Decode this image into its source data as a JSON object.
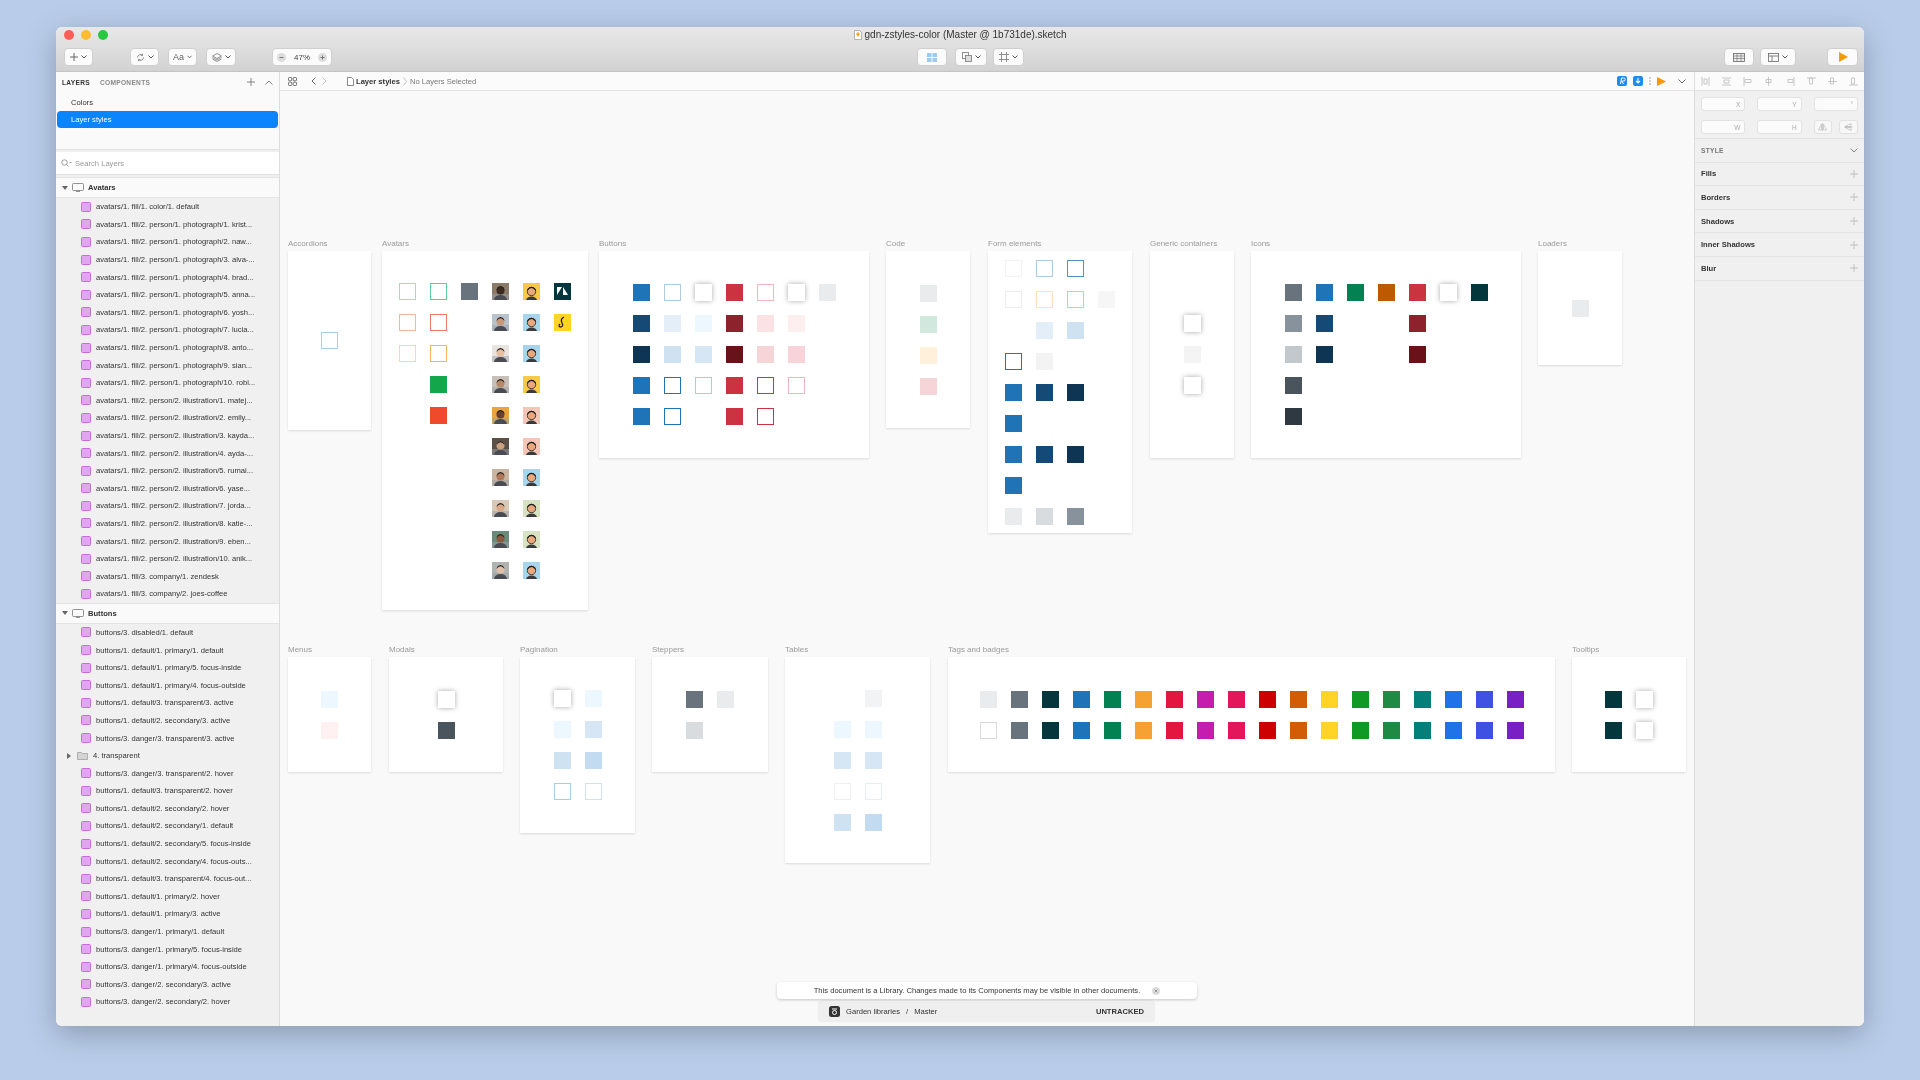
{
  "window": {
    "title": "gdn-zstyles-color (Master @ 1b731de).sketch"
  },
  "toolbar": {
    "text_tool": "Aa",
    "zoom": "47%"
  },
  "sidebar": {
    "tabs": [
      {
        "label": "LAYERS",
        "selected": true
      },
      {
        "label": "COMPONENTS",
        "selected": false
      }
    ],
    "pages": [
      {
        "label": "Colors",
        "selected": false
      },
      {
        "label": "Layer styles",
        "selected": true
      }
    ],
    "search": {
      "placeholder": "Search Layers"
    },
    "groups": [
      {
        "name": "Avatars",
        "expanded": true,
        "children": [
          {
            "kind": "style",
            "label": "avatars/1. fill/1. color/1. default"
          },
          {
            "kind": "style",
            "label": "avatars/1. fill/2. person/1. photograph/1. krist..."
          },
          {
            "kind": "style",
            "label": "avatars/1. fill/2. person/1. photograph/2. naw..."
          },
          {
            "kind": "style",
            "label": "avatars/1. fill/2. person/1. photograph/3. alva-..."
          },
          {
            "kind": "style",
            "label": "avatars/1. fill/2. person/1. photograph/4. brad..."
          },
          {
            "kind": "style",
            "label": "avatars/1. fill/2. person/1. photograph/5. anna..."
          },
          {
            "kind": "style",
            "label": "avatars/1. fill/2. person/1. photograph/6. yosh..."
          },
          {
            "kind": "style",
            "label": "avatars/1. fill/2. person/1. photograph/7. lucia..."
          },
          {
            "kind": "style",
            "label": "avatars/1. fill/2. person/1. photograph/8. anto..."
          },
          {
            "kind": "style",
            "label": "avatars/1. fill/2. person/1. photograph/9. sian..."
          },
          {
            "kind": "style",
            "label": "avatars/1. fill/2. person/1. photograph/10. robi..."
          },
          {
            "kind": "style",
            "label": "avatars/1. fill/2. person/2. illustration/1. matej..."
          },
          {
            "kind": "style",
            "label": "avatars/1. fill/2. person/2. illustration/2. emily..."
          },
          {
            "kind": "style",
            "label": "avatars/1. fill/2. person/2. illustration/3. kayda..."
          },
          {
            "kind": "style",
            "label": "avatars/1. fill/2. person/2. illustration/4. ayda-..."
          },
          {
            "kind": "style",
            "label": "avatars/1. fill/2. person/2. illustration/5. rumai..."
          },
          {
            "kind": "style",
            "label": "avatars/1. fill/2. person/2. illustration/6. yase..."
          },
          {
            "kind": "style",
            "label": "avatars/1. fill/2. person/2. illustration/7. jorda..."
          },
          {
            "kind": "style",
            "label": "avatars/1. fill/2. person/2. illustration/8. katie-..."
          },
          {
            "kind": "style",
            "label": "avatars/1. fill/2. person/2. illustration/9. eben..."
          },
          {
            "kind": "style",
            "label": "avatars/1. fill/2. person/2. illustration/10. anik..."
          },
          {
            "kind": "style",
            "label": "avatars/1. fill/3. company/1. zendesk"
          },
          {
            "kind": "style",
            "label": "avatars/1. fill/3. company/2. joes-coffee"
          }
        ]
      },
      {
        "name": "Buttons",
        "expanded": true,
        "children": [
          {
            "kind": "style",
            "label": "buttons/3. disabled/1. default"
          },
          {
            "kind": "style",
            "label": "buttons/1. default/1. primary/1. default"
          },
          {
            "kind": "style",
            "label": "buttons/1. default/1. primary/5. focus-inside"
          },
          {
            "kind": "style",
            "label": "buttons/1. default/1. primary/4. focus-outside"
          },
          {
            "kind": "style",
            "label": "buttons/1. default/3. transparent/3. active"
          },
          {
            "kind": "style",
            "label": "buttons/1. default/2. secondary/3. active"
          },
          {
            "kind": "style",
            "label": "buttons/3. danger/3. transparent/3. active"
          },
          {
            "kind": "folder",
            "label": "4. transparent",
            "expanded": false
          },
          {
            "kind": "style",
            "label": "buttons/3. danger/3. transparent/2. hover"
          },
          {
            "kind": "style",
            "label": "buttons/1. default/3. transparent/2. hover"
          },
          {
            "kind": "style",
            "label": "buttons/1. default/2. secondary/2. hover"
          },
          {
            "kind": "style",
            "label": "buttons/1. default/2. secondary/1. default"
          },
          {
            "kind": "style",
            "label": "buttons/1. default/2. secondary/5. focus-inside"
          },
          {
            "kind": "style",
            "label": "buttons/1. default/2. secondary/4. focus-outs..."
          },
          {
            "kind": "style",
            "label": "buttons/1. default/3. transparent/4. focus-out..."
          },
          {
            "kind": "style",
            "label": "buttons/1. default/1. primary/2. hover"
          },
          {
            "kind": "style",
            "label": "buttons/1. default/1. primary/3. active"
          },
          {
            "kind": "style",
            "label": "buttons/3. danger/1. primary/1. default"
          },
          {
            "kind": "style",
            "label": "buttons/3. danger/1. primary/5. focus-inside"
          },
          {
            "kind": "style",
            "label": "buttons/3. danger/1. primary/4. focus-outside"
          },
          {
            "kind": "style",
            "label": "buttons/3. danger/2. secondary/3. active"
          },
          {
            "kind": "style",
            "label": "buttons/3. danger/2. secondary/2. hover"
          }
        ]
      }
    ]
  },
  "breadcrumb": {
    "page": "Layer styles",
    "selection": "No Layers Selected"
  },
  "canvas": {
    "artboards": [
      {
        "title": "Accordions",
        "rows": [
          [
            {
              "kind": "outline",
              "color": "#adcce4"
            }
          ]
        ]
      },
      {
        "title": "Avatars",
        "rows": [
          [
            {
              "kind": "outline",
              "color": "#9fe0bf"
            },
            {
              "kind": "outline",
              "color": "#5ccf96"
            },
            {
              "kind": "fill",
              "color": "#68737d"
            },
            {
              "kind": "picture"
            },
            {
              "kind": "person",
              "color": "#f7c948"
            },
            {
              "kind": "logo",
              "color": "#03363d"
            }
          ],
          [
            {
              "kind": "outline",
              "color": "#f9b2a7"
            },
            {
              "kind": "outline",
              "color": "#f07a68"
            },
            {
              "kind": "gap"
            },
            {
              "kind": "picture"
            },
            {
              "kind": "person",
              "color": "#a8d4ec"
            },
            {
              "kind": "logo",
              "color": "#ffd424"
            }
          ],
          [
            {
              "kind": "outline",
              "color": "#fdd6a0"
            },
            {
              "kind": "outline",
              "color": "#f9b45a"
            },
            {
              "kind": "gap"
            },
            {
              "kind": "picture"
            },
            {
              "kind": "person",
              "color": "#a8d4ec"
            }
          ],
          [
            {
              "kind": "gap"
            },
            {
              "kind": "fill",
              "color": "#13a64a"
            },
            {
              "kind": "gap"
            },
            {
              "kind": "picture"
            },
            {
              "kind": "person",
              "color": "#f7c948"
            }
          ],
          [
            {
              "kind": "gap"
            },
            {
              "kind": "fill",
              "color": "#ef4a2c"
            },
            {
              "kind": "gap"
            },
            {
              "kind": "picture"
            },
            {
              "kind": "person",
              "color": "#f5c6b8"
            }
          ],
          [
            {
              "kind": "gap"
            },
            {
              "kind": "gap"
            },
            {
              "kind": "gap"
            },
            {
              "kind": "picture"
            },
            {
              "kind": "person",
              "color": "#f5c6b8"
            }
          ],
          [
            {
              "kind": "gap"
            },
            {
              "kind": "gap"
            },
            {
              "kind": "gap"
            },
            {
              "kind": "picture"
            },
            {
              "kind": "person",
              "color": "#a8d4ec"
            }
          ],
          [
            {
              "kind": "gap"
            },
            {
              "kind": "gap"
            },
            {
              "kind": "gap"
            },
            {
              "kind": "picture"
            },
            {
              "kind": "person",
              "color": "#d7e2c2"
            }
          ],
          [
            {
              "kind": "gap"
            },
            {
              "kind": "gap"
            },
            {
              "kind": "gap"
            },
            {
              "kind": "picture"
            },
            {
              "kind": "person",
              "color": "#d7e2c2"
            }
          ],
          [
            {
              "kind": "gap"
            },
            {
              "kind": "gap"
            },
            {
              "kind": "gap"
            },
            {
              "kind": "picture"
            },
            {
              "kind": "person",
              "color": "#a8d4ec"
            }
          ]
        ]
      },
      {
        "title": "Buttons",
        "rows": [
          [
            {
              "kind": "fill",
              "color": "#1f73b7"
            },
            {
              "kind": "outline",
              "color": "#adcce4"
            },
            {
              "kind": "shadow"
            },
            {
              "kind": "fill",
              "color": "#cc3340"
            },
            {
              "kind": "outline",
              "color": "#f5b5ba"
            },
            {
              "kind": "shadow"
            },
            {
              "kind": "fill",
              "color": "#e9ebed"
            }
          ],
          [
            {
              "kind": "fill",
              "color": "#144a75"
            },
            {
              "kind": "fill",
              "color": "#e3eef8"
            },
            {
              "kind": "fill",
              "color": "#edf7ff"
            },
            {
              "kind": "fill",
              "color": "#8c232c"
            },
            {
              "kind": "fill",
              "color": "#fbe3e5"
            },
            {
              "kind": "fill",
              "color": "#fdeff0"
            }
          ],
          [
            {
              "kind": "fill",
              "color": "#0f3554"
            },
            {
              "kind": "fill",
              "color": "#cee2f2"
            },
            {
              "kind": "fill",
              "color": "#d6e6f5"
            },
            {
              "kind": "fill",
              "color": "#681219"
            },
            {
              "kind": "fill",
              "color": "#f5d5d8"
            },
            {
              "kind": "fill",
              "color": "#f8d3d9"
            }
          ],
          [
            {
              "kind": "fill",
              "color": "#1f73b7"
            },
            {
              "kind": "outline",
              "color": "#1f73b7"
            },
            {
              "kind": "outline",
              "color": "#adcce4"
            },
            {
              "kind": "fill",
              "color": "#cc3340"
            },
            {
              "kind": "outline",
              "color": "#cc3340"
            },
            {
              "kind": "outline",
              "color": "#f5b5ba"
            }
          ],
          [
            {
              "kind": "fill",
              "color": "#1f73b7"
            },
            {
              "kind": "outline",
              "color": "#1f73b7"
            },
            {
              "kind": "gap"
            },
            {
              "kind": "fill",
              "color": "#cc3340"
            },
            {
              "kind": "outline",
              "color": "#cc3340"
            }
          ]
        ]
      },
      {
        "title": "Code",
        "rows": [
          [
            {
              "kind": "fill",
              "color": "#e9ebed"
            }
          ],
          [
            {
              "kind": "fill",
              "color": "#d1e8df"
            }
          ],
          [
            {
              "kind": "fill",
              "color": "#fff0db"
            }
          ],
          [
            {
              "kind": "fill",
              "color": "#f5d5d8"
            }
          ]
        ]
      },
      {
        "title": "Form elements",
        "rows": [
          [
            {
              "kind": "outline",
              "color": "#f2f2f2"
            },
            {
              "kind": "outline",
              "color": "#adcce4"
            },
            {
              "kind": "outline",
              "color": "#5293c7"
            }
          ],
          [
            {
              "kind": "outline",
              "color": "#ececec"
            },
            {
              "kind": "outline",
              "color": "#fde3bd"
            },
            {
              "kind": "outline",
              "color": "#f5b5ba"
            },
            {
              "kind": "fill",
              "color": "#f6f6f6"
            }
          ],
          [
            {
              "kind": "gap"
            },
            {
              "kind": "fill",
              "color": "#e3eef8"
            },
            {
              "kind": "fill",
              "color": "#cee2f2"
            }
          ],
          [
            {
              "kind": "outline",
              "color": "#1f73b7"
            },
            {
              "kind": "fill",
              "color": "#f3f3f3"
            }
          ],
          [
            {
              "kind": "fill",
              "color": "#1f73b7"
            },
            {
              "kind": "fill",
              "color": "#144a75"
            },
            {
              "kind": "fill",
              "color": "#0f3554"
            }
          ],
          [
            {
              "kind": "fill",
              "color": "#1f73b7"
            }
          ],
          [
            {
              "kind": "fill",
              "color": "#1f73b7"
            },
            {
              "kind": "fill",
              "color": "#144a75"
            },
            {
              "kind": "fill",
              "color": "#0f3554"
            }
          ],
          [
            {
              "kind": "fill",
              "color": "#1f73b7"
            }
          ],
          [
            {
              "kind": "fill",
              "color": "#e9ebed"
            },
            {
              "kind": "fill",
              "color": "#d8dcde"
            },
            {
              "kind": "fill",
              "color": "#87929d"
            }
          ]
        ]
      },
      {
        "title": "Generic containers",
        "rows": [
          [
            {
              "kind": "shadow"
            }
          ],
          [
            {
              "kind": "fill",
              "color": "#f4f4f4"
            }
          ],
          [
            {
              "kind": "shadow"
            }
          ]
        ]
      },
      {
        "title": "Icons",
        "rows": [
          [
            {
              "kind": "fill",
              "color": "#68737d"
            },
            {
              "kind": "fill",
              "color": "#1f73b7"
            },
            {
              "kind": "fill",
              "color": "#038153"
            },
            {
              "kind": "fill",
              "color": "#bd5a00"
            },
            {
              "kind": "fill",
              "color": "#cc3340"
            },
            {
              "kind": "shadow"
            },
            {
              "kind": "fill",
              "color": "#03363d"
            }
          ],
          [
            {
              "kind": "fill",
              "color": "#87929d"
            },
            {
              "kind": "fill",
              "color": "#144a75"
            },
            {
              "kind": "gap"
            },
            {
              "kind": "gap"
            },
            {
              "kind": "fill",
              "color": "#8c232c"
            }
          ],
          [
            {
              "kind": "fill",
              "color": "#c2c8cc"
            },
            {
              "kind": "fill",
              "color": "#0f3554"
            },
            {
              "kind": "gap"
            },
            {
              "kind": "gap"
            },
            {
              "kind": "fill",
              "color": "#681219"
            }
          ],
          [
            {
              "kind": "fill",
              "color": "#49545c"
            }
          ],
          [
            {
              "kind": "fill",
              "color": "#2f3941"
            }
          ]
        ]
      },
      {
        "title": "Loaders",
        "rows": [
          [
            {
              "kind": "fill",
              "color": "#e9ebed"
            }
          ]
        ]
      },
      {
        "title": "Menus",
        "rows": [
          [
            {
              "kind": "fill",
              "color": "#edf7ff"
            }
          ],
          [
            {
              "kind": "fill",
              "color": "#fff0f1"
            }
          ]
        ]
      },
      {
        "title": "Modals",
        "rows": [
          [
            {
              "kind": "shadow"
            }
          ],
          [
            {
              "kind": "fill",
              "color": "#49545c"
            }
          ]
        ]
      },
      {
        "title": "Pagination",
        "rows": [
          [
            {
              "kind": "shadow"
            },
            {
              "kind": "fill",
              "color": "#edf7ff"
            }
          ],
          [
            {
              "kind": "fill",
              "color": "#edf7ff"
            },
            {
              "kind": "fill",
              "color": "#d6e6f5"
            }
          ],
          [
            {
              "kind": "fill",
              "color": "#cee2f2"
            },
            {
              "kind": "fill",
              "color": "#c3dbf0"
            }
          ],
          [
            {
              "kind": "outline",
              "color": "#adcce4"
            },
            {
              "kind": "outline",
              "color": "#cee2f2"
            }
          ]
        ]
      },
      {
        "title": "Steppers",
        "rows": [
          [
            {
              "kind": "fill",
              "color": "#68737d"
            },
            {
              "kind": "fill",
              "color": "#e9ebed"
            }
          ],
          [
            {
              "kind": "fill",
              "color": "#d8dcde"
            }
          ]
        ]
      },
      {
        "title": "Tables",
        "rows": [
          [
            {
              "kind": "gap"
            },
            {
              "kind": "fill",
              "color": "#f1f3f4"
            }
          ],
          [
            {
              "kind": "fill",
              "color": "#edf7ff"
            },
            {
              "kind": "fill",
              "color": "#edf7ff"
            }
          ],
          [
            {
              "kind": "fill",
              "color": "#d6e6f5"
            },
            {
              "kind": "fill",
              "color": "#d6e6f5"
            }
          ],
          [
            {
              "kind": "outline",
              "color": "#f0f0f0"
            },
            {
              "kind": "outline",
              "color": "#e3eef8"
            }
          ],
          [
            {
              "kind": "fill",
              "color": "#cee2f2"
            },
            {
              "kind": "fill",
              "color": "#c3dbf0"
            }
          ]
        ]
      },
      {
        "title": "Tags and badges",
        "rows": [
          [
            {
              "kind": "fill",
              "color": "#e9ebed"
            },
            {
              "kind": "fill",
              "color": "#68737d"
            },
            {
              "kind": "fill",
              "color": "#03363d"
            },
            {
              "kind": "fill",
              "color": "#1f73b7"
            },
            {
              "kind": "fill",
              "color": "#038153"
            },
            {
              "kind": "fill",
              "color": "#f5a133"
            },
            {
              "kind": "fill",
              "color": "#e3163f"
            },
            {
              "kind": "fill",
              "color": "#c41eaf"
            },
            {
              "kind": "fill",
              "color": "#e3165b"
            },
            {
              "kind": "fill",
              "color": "#cc0000"
            },
            {
              "kind": "fill",
              "color": "#d15e07"
            },
            {
              "kind": "fill",
              "color": "#ffd424"
            },
            {
              "kind": "fill",
              "color": "#0f9a25"
            },
            {
              "kind": "fill",
              "color": "#1f8a44"
            },
            {
              "kind": "fill",
              "color": "#028079"
            },
            {
              "kind": "fill",
              "color": "#1f73e7"
            },
            {
              "kind": "fill",
              "color": "#3f51e3"
            },
            {
              "kind": "fill",
              "color": "#7a1fc4"
            }
          ],
          [
            {
              "kind": "outline",
              "color": "#d8dcde"
            },
            {
              "kind": "fill",
              "color": "#68737d"
            },
            {
              "kind": "fill",
              "color": "#03363d"
            },
            {
              "kind": "fill",
              "color": "#1f73b7"
            },
            {
              "kind": "fill",
              "color": "#038153"
            },
            {
              "kind": "fill",
              "color": "#f5a133"
            },
            {
              "kind": "fill",
              "color": "#e3163f"
            },
            {
              "kind": "fill",
              "color": "#c41eaf"
            },
            {
              "kind": "fill",
              "color": "#e3165b"
            },
            {
              "kind": "fill",
              "color": "#cc0000"
            },
            {
              "kind": "fill",
              "color": "#d15e07"
            },
            {
              "kind": "fill",
              "color": "#ffd424"
            },
            {
              "kind": "fill",
              "color": "#0f9a25"
            },
            {
              "kind": "fill",
              "color": "#1f8a44"
            },
            {
              "kind": "fill",
              "color": "#028079"
            },
            {
              "kind": "fill",
              "color": "#1f73e7"
            },
            {
              "kind": "fill",
              "color": "#3f51e3"
            },
            {
              "kind": "fill",
              "color": "#7a1fc4"
            }
          ]
        ]
      },
      {
        "title": "Tooltips",
        "rows": [
          [
            {
              "kind": "fill",
              "color": "#03363d"
            },
            {
              "kind": "shadow"
            }
          ],
          [
            {
              "kind": "fill",
              "color": "#03363d"
            },
            {
              "kind": "shadow"
            }
          ]
        ]
      }
    ]
  },
  "notification": {
    "text": "This document is a Library. Changes made to its Components may be visible in other documents."
  },
  "status_bar": {
    "library": "Garden libraries",
    "separator": "/",
    "branch": "Master",
    "status": "UNTRACKED"
  },
  "inspector": {
    "fields": [
      {
        "label": "X"
      },
      {
        "label": "Y"
      },
      {
        "label": "°"
      },
      {
        "label": "W"
      },
      {
        "label": "H"
      }
    ],
    "style_header": "STYLE",
    "sections": [
      "Fills",
      "Borders",
      "Shadows",
      "Inner Shadows",
      "Blur"
    ]
  }
}
